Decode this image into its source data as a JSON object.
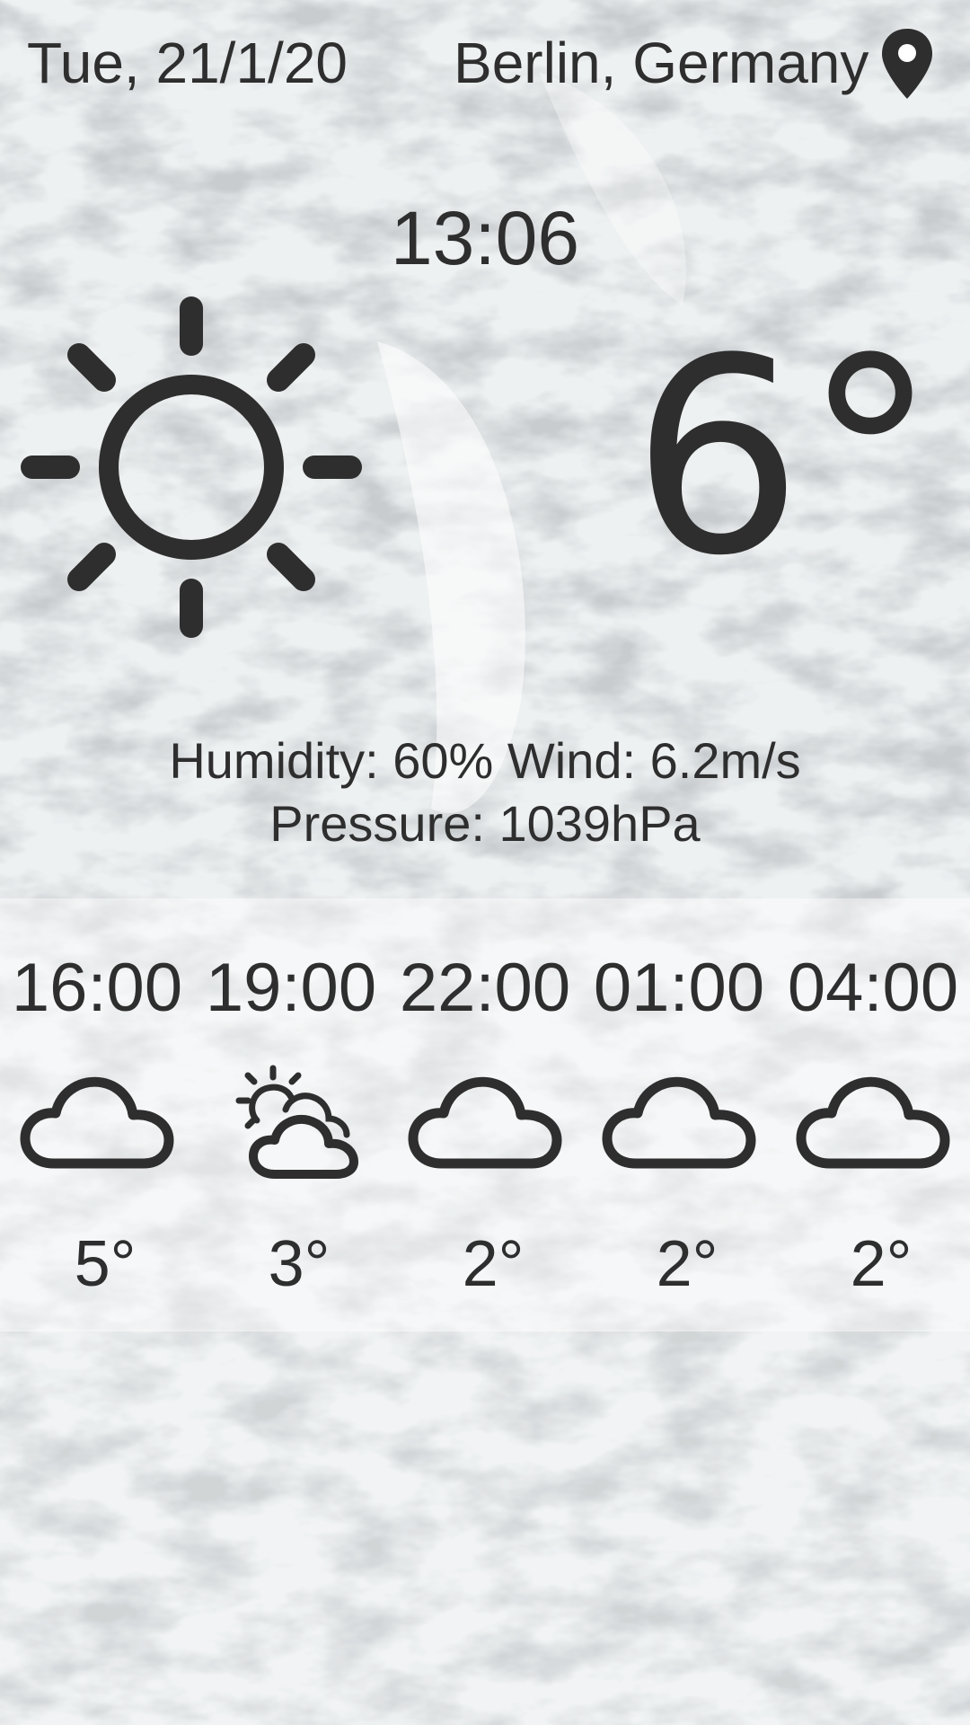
{
  "header": {
    "date": "Tue, 21/1/20",
    "location": "Berlin, Germany",
    "location_icon": "map-pin-icon"
  },
  "current": {
    "time": "13:06",
    "condition_icon": "sun-icon",
    "temperature": "6°"
  },
  "details": {
    "line1": "Humidity: 60% Wind: 6.2m/s",
    "line2": "Pressure: 1039hPa"
  },
  "forecast": [
    {
      "time": "16:00",
      "icon": "cloud-icon",
      "temp": "5°"
    },
    {
      "time": "19:00",
      "icon": "partly-cloudy-icon",
      "temp": "3°"
    },
    {
      "time": "22:00",
      "icon": "cloud-icon",
      "temp": "2°"
    },
    {
      "time": "01:00",
      "icon": "cloud-icon",
      "temp": "2°"
    },
    {
      "time": "04:00",
      "icon": "cloud-icon",
      "temp": "2°"
    }
  ],
  "colors": {
    "text": "#2e2e2e",
    "background": "#e9ecee"
  }
}
